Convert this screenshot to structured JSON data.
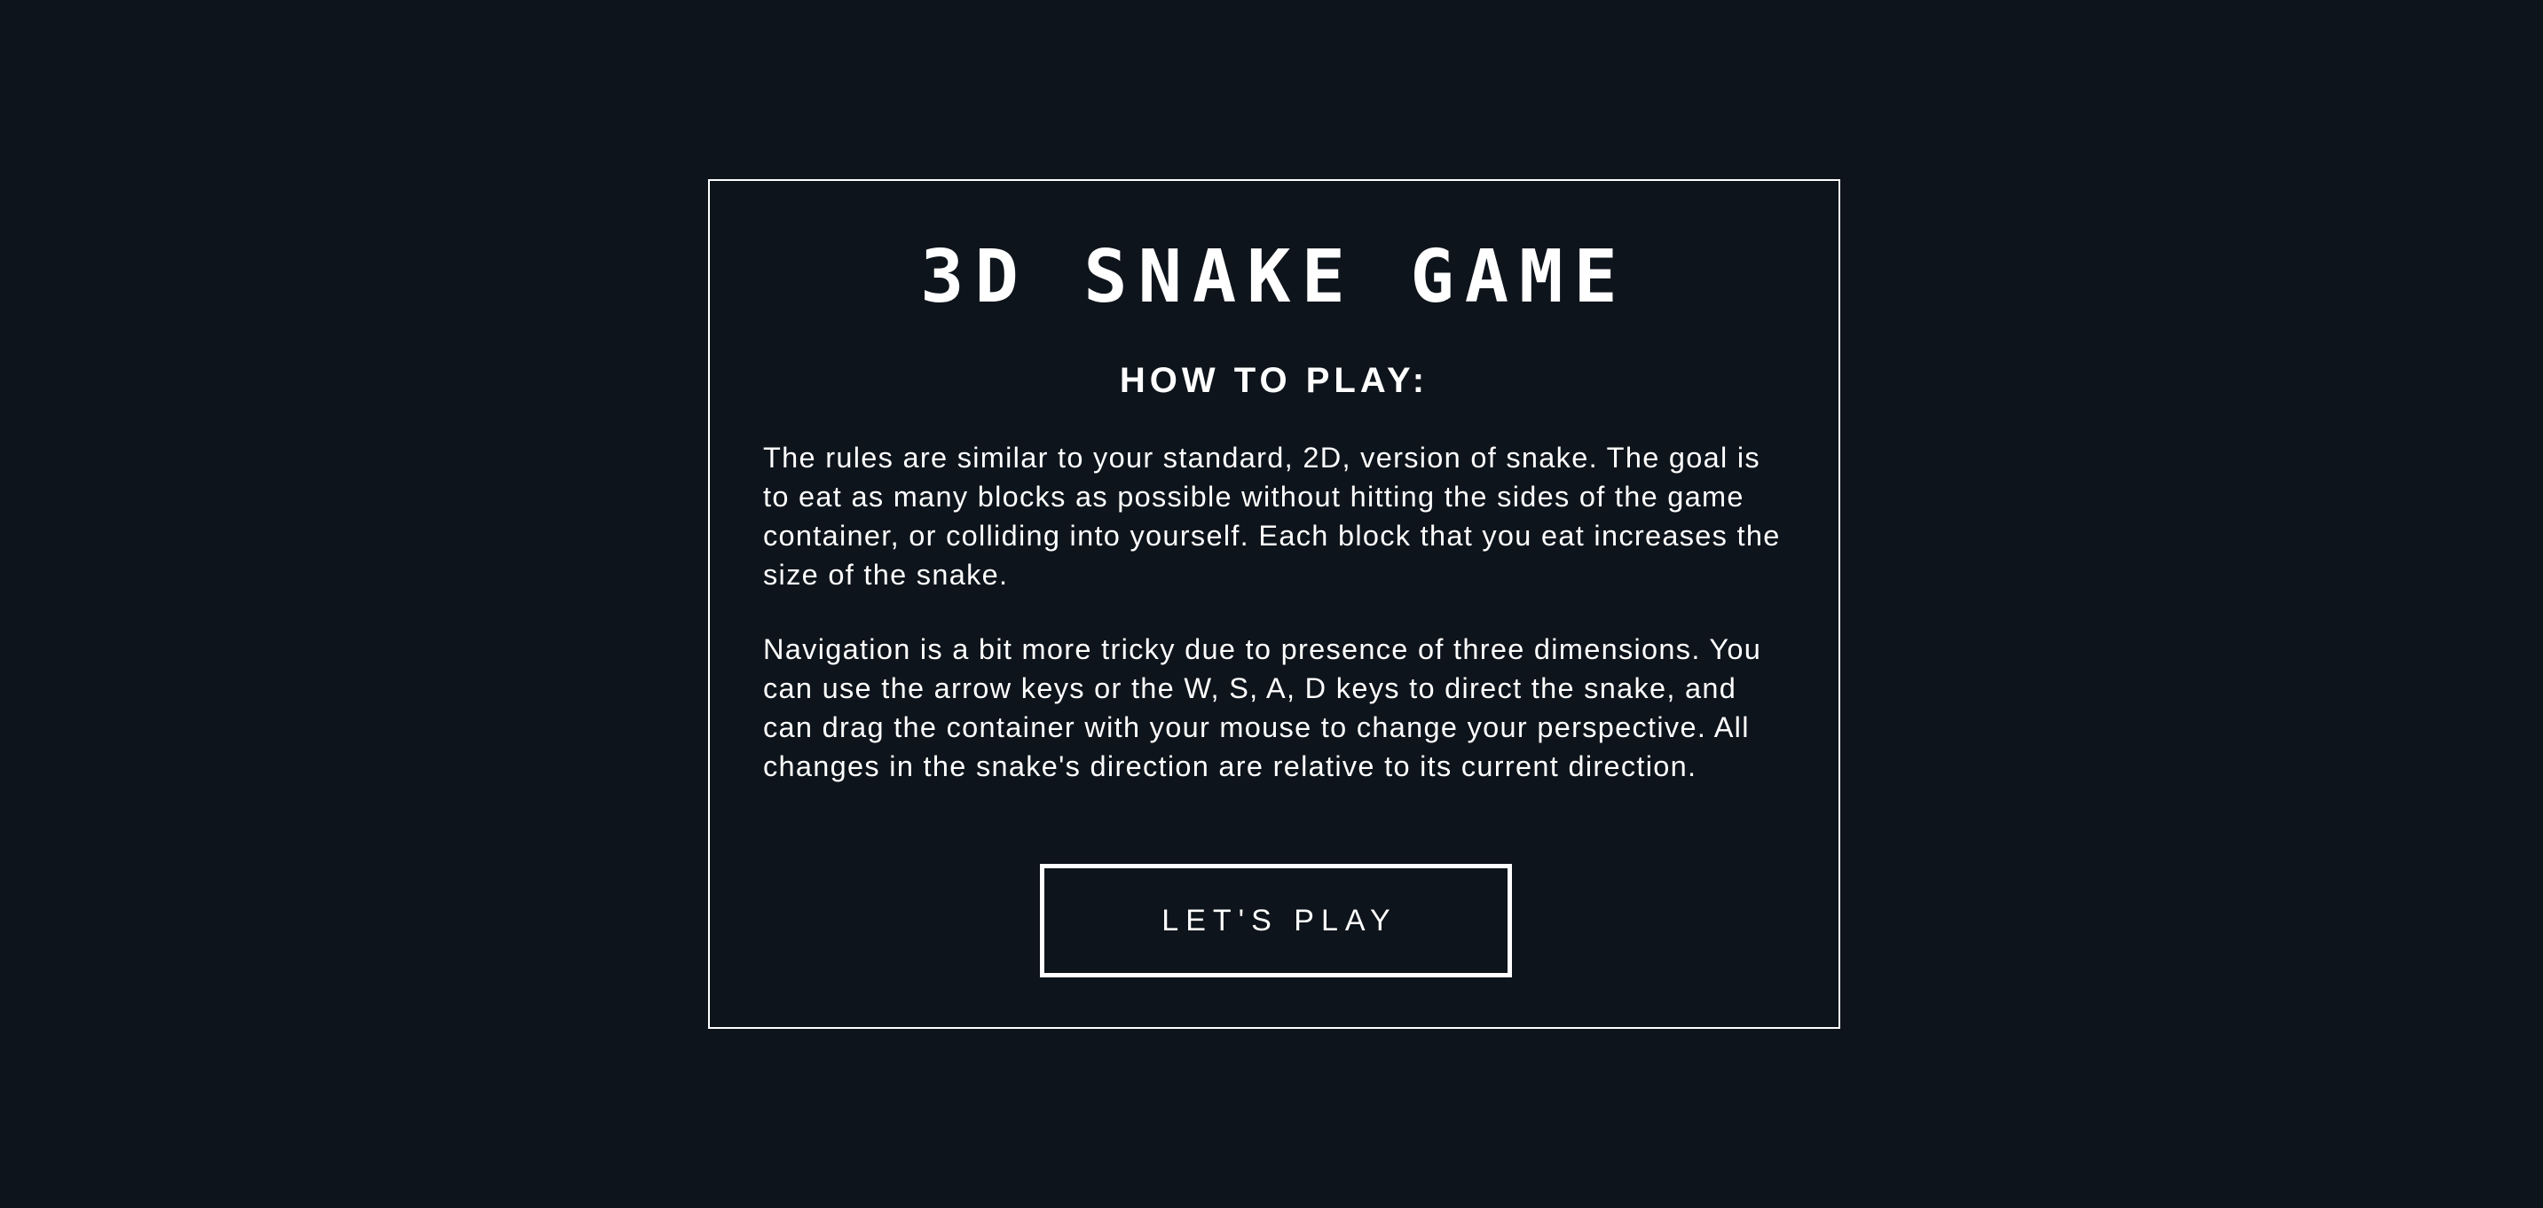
{
  "modal": {
    "title": "3D SNAKE GAME",
    "heading": "HOW TO PLAY:",
    "paragraphs": [
      "The rules are similar to your standard, 2D, version of snake. The goal is to eat as many blocks as possible without hitting the sides of the game container, or colliding into yourself. Each block that you eat increases the size of the snake.",
      "Navigation is a bit more tricky due to presence of three dimensions. You can use the arrow keys or the W, S, A, D keys to direct the snake, and can drag the container with your mouse to change your perspective. All changes in the snake's direction are relative to its current direction."
    ],
    "play_button_label": "LET'S PLAY"
  },
  "colors": {
    "background": "#0e141b",
    "foreground": "#ffffff"
  }
}
